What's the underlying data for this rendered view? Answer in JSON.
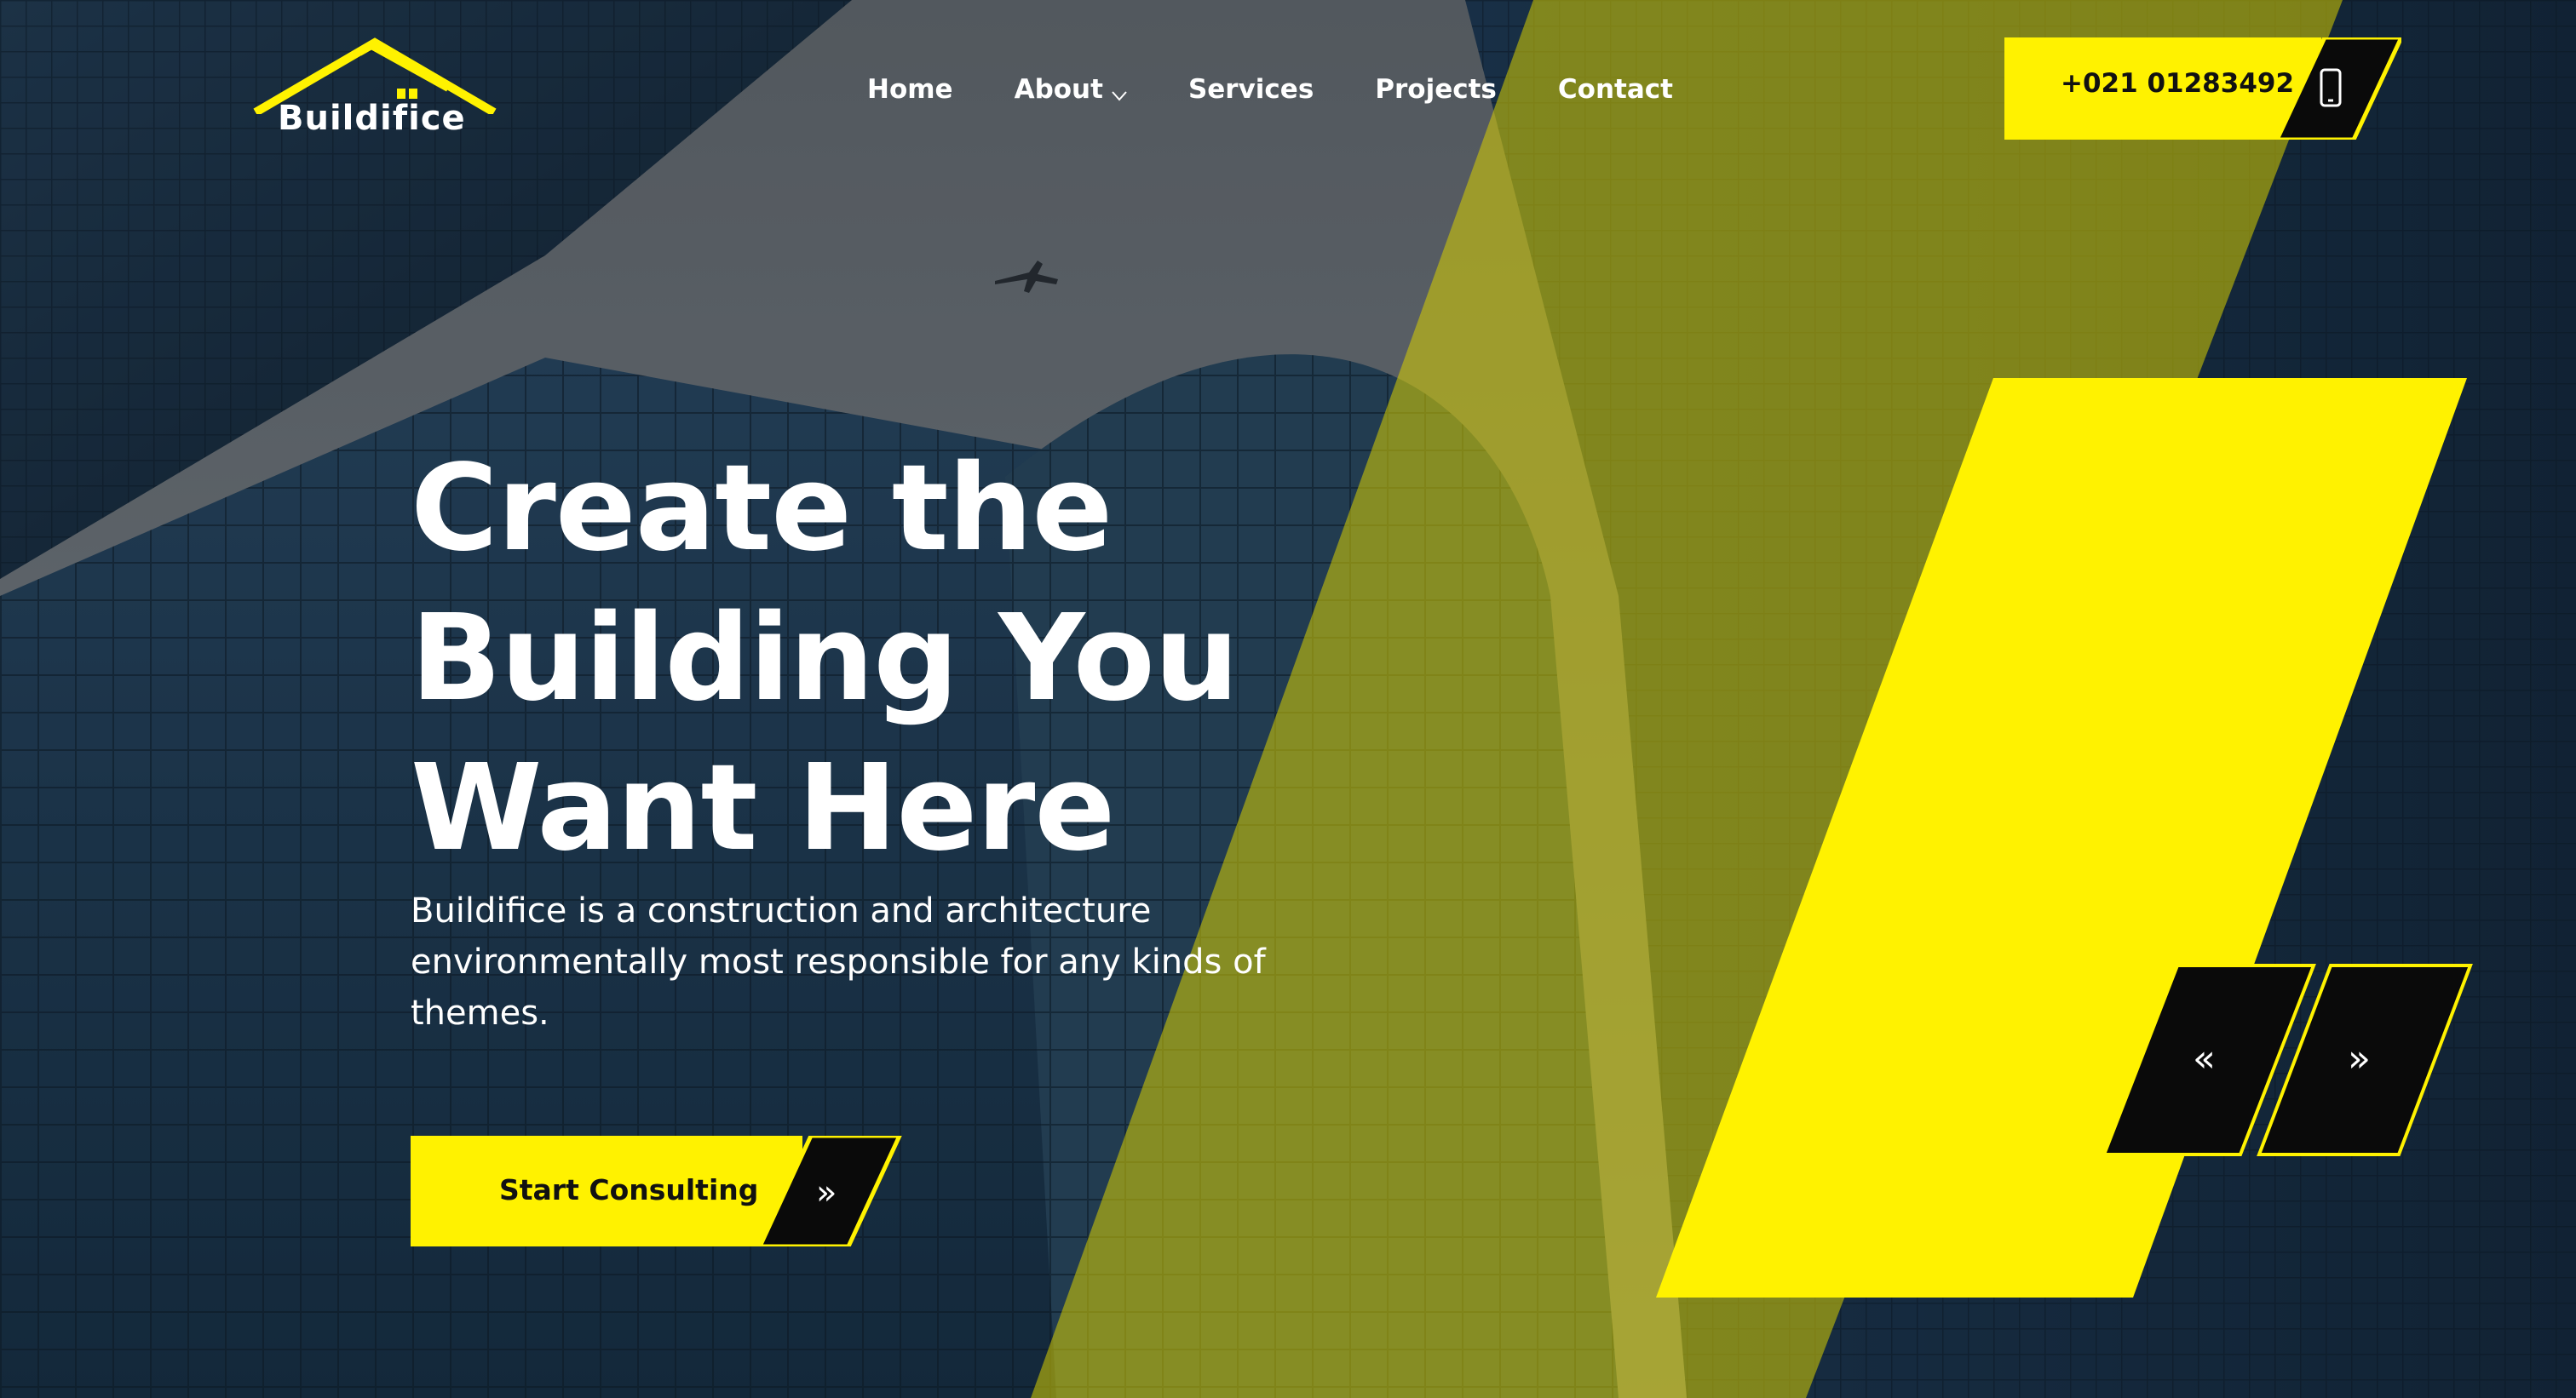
{
  "brand": {
    "name": "Buildifice",
    "accent_color": "#fff200",
    "dark_color": "#0a0a0a"
  },
  "nav": {
    "items": [
      {
        "label": "Home"
      },
      {
        "label": "About"
      },
      {
        "label": "Services"
      },
      {
        "label": "Projects"
      },
      {
        "label": "Contact"
      }
    ]
  },
  "header": {
    "phone": "+021 01283492",
    "phone_icon": "mobile-phone-icon"
  },
  "hero": {
    "headline_lines": [
      "Create the",
      "Building You",
      "Want Here"
    ],
    "description": "Buildifice is a construction and architecture environmentally most responsible for any kinds of themes.",
    "cta_label": "Start Consulting",
    "cta_icon": "double-chevron-right-icon"
  },
  "slider": {
    "prev_icon": "double-chevron-left-icon",
    "next_icon": "double-chevron-right-icon",
    "prev_glyph": "«",
    "next_glyph": "»"
  }
}
